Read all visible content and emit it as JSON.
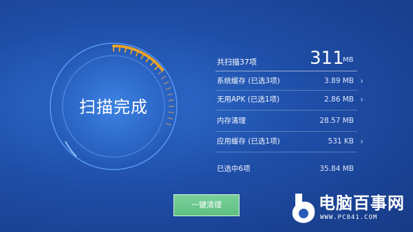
{
  "scan": {
    "status_title": "扫描完成"
  },
  "summary": {
    "label": "共扫描37项",
    "total_value": "311",
    "total_unit": "MB"
  },
  "items": [
    {
      "label": "系统缓存 (已选3项)",
      "size": "3.89 MB",
      "has_chevron": true
    },
    {
      "label": "无用APK (已选1项)",
      "size": "2.86 MB",
      "has_chevron": true
    },
    {
      "label": "内存清理",
      "size": "28.57 MB",
      "has_chevron": false
    },
    {
      "label": "应用缓存 (已选1项)",
      "size": "531 KB",
      "has_chevron": true
    }
  ],
  "selected": {
    "label": "已选中6项",
    "size": "35.84 MB"
  },
  "action": {
    "clean_label": "一键清理"
  },
  "watermark": {
    "title": "电脑百事网",
    "url": "WWW.PC841.COM"
  },
  "icons": {
    "chevron": "›"
  },
  "colors": {
    "background": "#1f4ea8",
    "ring_accent": "#f5a623",
    "button": "#6cc78d"
  }
}
